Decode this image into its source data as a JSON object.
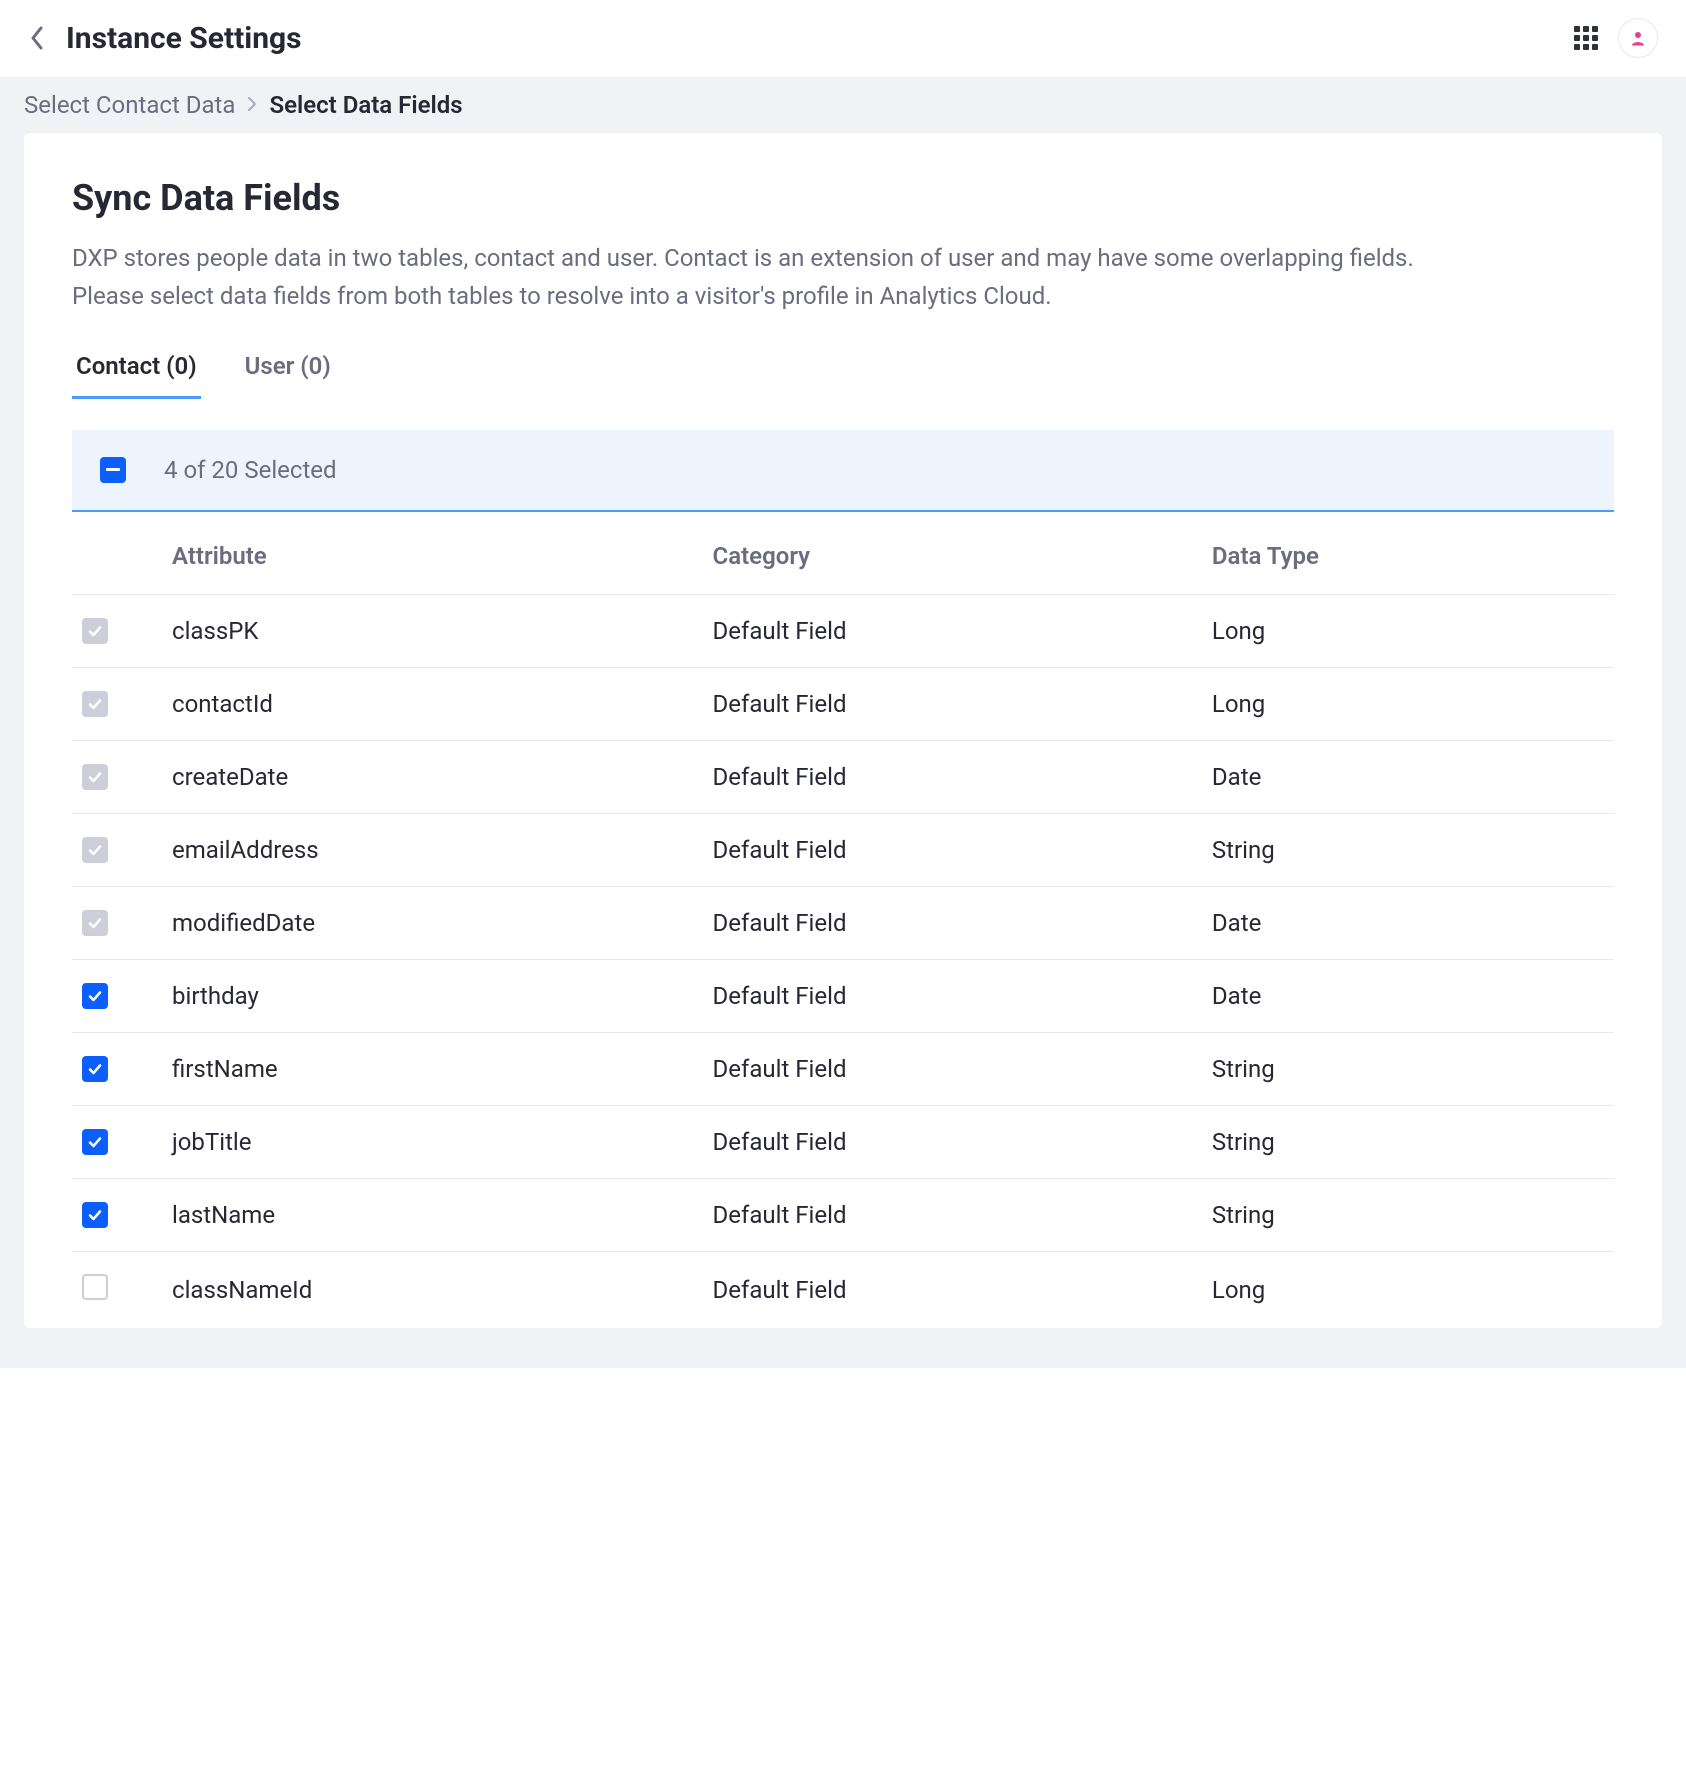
{
  "topbar": {
    "title": "Instance Settings"
  },
  "breadcrumb": {
    "parent": "Select Contact Data",
    "current": "Select Data Fields"
  },
  "card": {
    "heading": "Sync Data Fields",
    "description": "DXP stores people data in two tables, contact and user. Contact is an extension of user and may have some overlapping fields. Please select data fields from both tables to resolve into a visitor's profile in Analytics Cloud."
  },
  "tabs": [
    {
      "label": "Contact (0)",
      "active": true
    },
    {
      "label": "User (0)",
      "active": false
    }
  ],
  "selection": {
    "text": "4 of 20 Selected"
  },
  "table": {
    "headers": {
      "attribute": "Attribute",
      "category": "Category",
      "dataType": "Data Type"
    },
    "rows": [
      {
        "attribute": "classPK",
        "category": "Default Field",
        "dataType": "Long",
        "state": "disabled"
      },
      {
        "attribute": "contactId",
        "category": "Default Field",
        "dataType": "Long",
        "state": "disabled"
      },
      {
        "attribute": "createDate",
        "category": "Default Field",
        "dataType": "Date",
        "state": "disabled"
      },
      {
        "attribute": "emailAddress",
        "category": "Default Field",
        "dataType": "String",
        "state": "disabled"
      },
      {
        "attribute": "modifiedDate",
        "category": "Default Field",
        "dataType": "Date",
        "state": "disabled"
      },
      {
        "attribute": "birthday",
        "category": "Default Field",
        "dataType": "Date",
        "state": "checked"
      },
      {
        "attribute": "firstName",
        "category": "Default Field",
        "dataType": "String",
        "state": "checked"
      },
      {
        "attribute": "jobTitle",
        "category": "Default Field",
        "dataType": "String",
        "state": "checked"
      },
      {
        "attribute": "lastName",
        "category": "Default Field",
        "dataType": "String",
        "state": "checked"
      },
      {
        "attribute": "classNameId",
        "category": "Default Field",
        "dataType": "Long",
        "state": "unchecked"
      }
    ]
  }
}
